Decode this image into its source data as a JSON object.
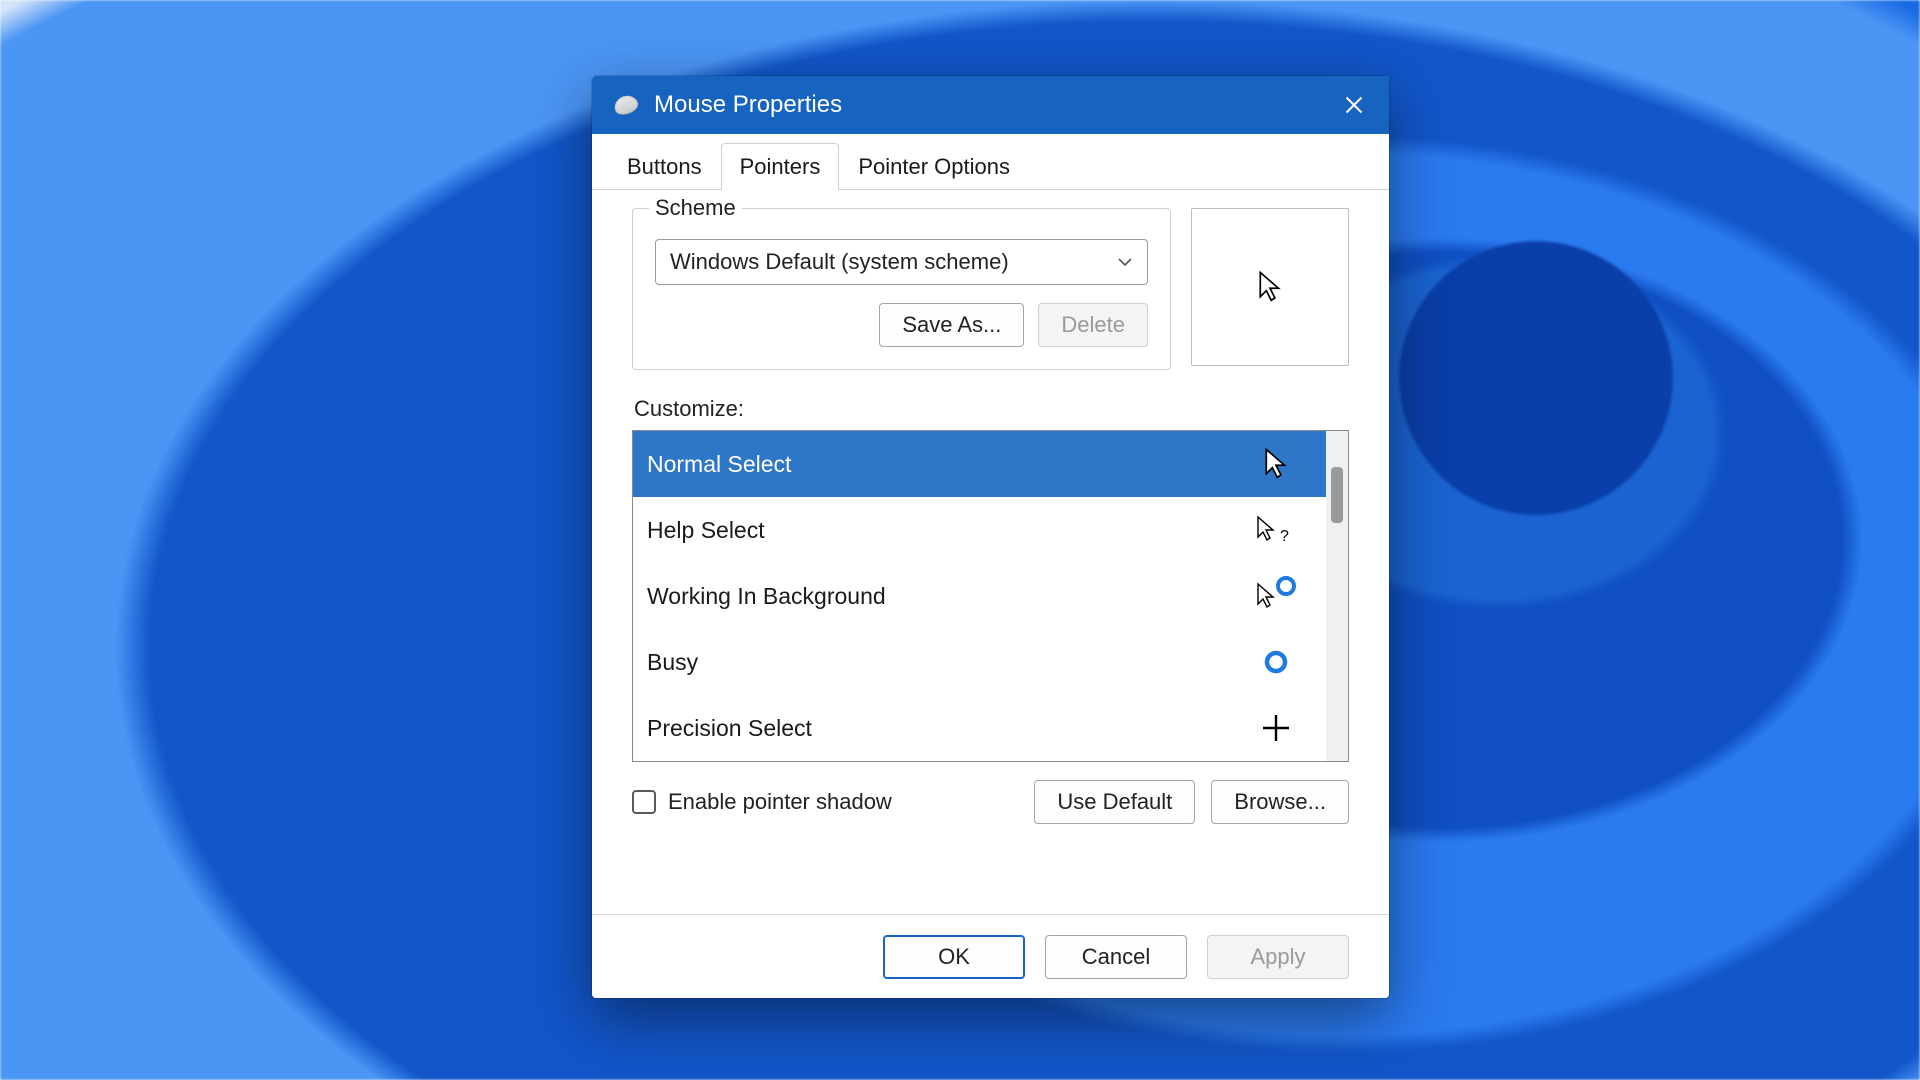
{
  "window": {
    "title": "Mouse Properties"
  },
  "tabs": [
    {
      "label": "Buttons",
      "active": false
    },
    {
      "label": "Pointers",
      "active": true
    },
    {
      "label": "Pointer Options",
      "active": false
    }
  ],
  "scheme": {
    "legend": "Scheme",
    "selected": "Windows Default (system scheme)",
    "save_as": "Save As...",
    "delete": "Delete",
    "delete_enabled": false
  },
  "preview_cursor": "normal-select",
  "customize": {
    "label": "Customize:",
    "items": [
      {
        "name": "Normal Select",
        "icon": "arrow",
        "selected": true
      },
      {
        "name": "Help Select",
        "icon": "arrow-help",
        "selected": false
      },
      {
        "name": "Working In Background",
        "icon": "arrow-ring",
        "selected": false
      },
      {
        "name": "Busy",
        "icon": "ring",
        "selected": false
      },
      {
        "name": "Precision Select",
        "icon": "crosshair",
        "selected": false
      }
    ]
  },
  "shadow": {
    "label": "Enable pointer shadow",
    "checked": false
  },
  "buttons": {
    "use_default": "Use Default",
    "browse": "Browse...",
    "ok": "OK",
    "cancel": "Cancel",
    "apply": "Apply",
    "apply_enabled": false
  },
  "colors": {
    "titlebar": "#1664c0",
    "selection": "#2e76c7",
    "accent_ring": "#1f7ae0"
  }
}
